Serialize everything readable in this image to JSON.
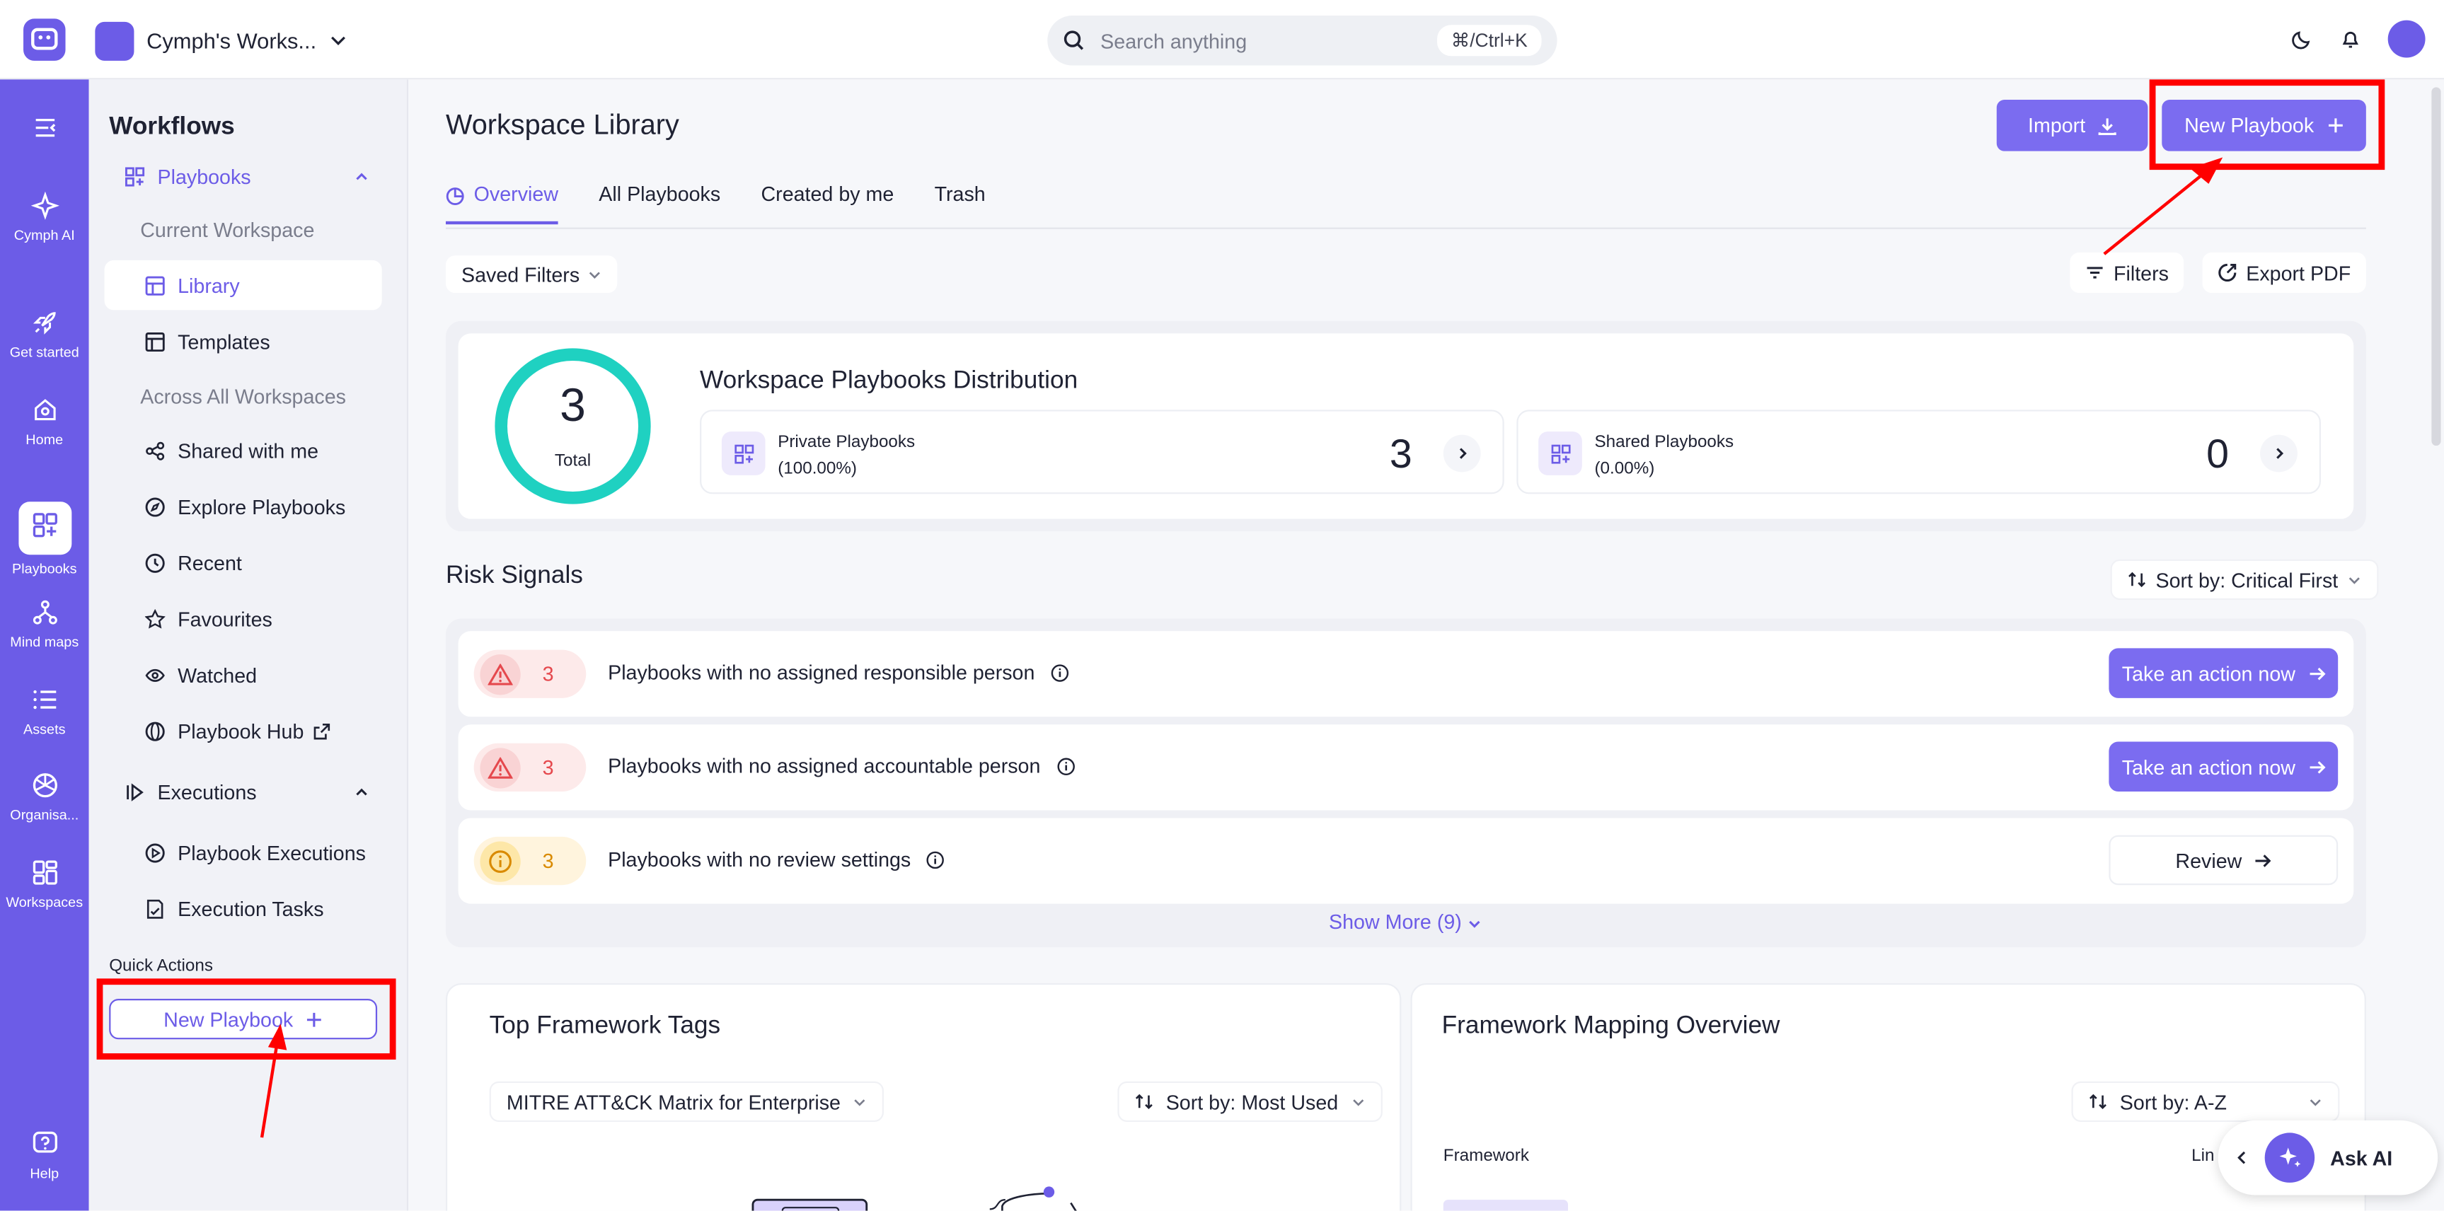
{
  "topbar": {
    "workspace_name": "Cymph's Works...",
    "search_placeholder": "Search anything",
    "search_shortcut": "⌘/Ctrl+K"
  },
  "rail": {
    "items": [
      {
        "label": "Cymph AI"
      },
      {
        "label": "Get started"
      },
      {
        "label": "Home"
      },
      {
        "label": "Playbooks"
      },
      {
        "label": "Mind maps"
      },
      {
        "label": "Assets"
      },
      {
        "label": "Organisa..."
      },
      {
        "label": "Workspaces"
      },
      {
        "label": "Help"
      }
    ]
  },
  "sidenav": {
    "title": "Workflows",
    "playbooks_group": "Playbooks",
    "current_workspace": "Current Workspace",
    "library": "Library",
    "templates": "Templates",
    "across_all": "Across All Workspaces",
    "shared_with_me": "Shared with me",
    "explore": "Explore Playbooks",
    "recent": "Recent",
    "favourites": "Favourites",
    "watched": "Watched",
    "hub": "Playbook Hub",
    "executions_group": "Executions",
    "playbook_executions": "Playbook Executions",
    "execution_tasks": "Execution Tasks",
    "quick_actions": "Quick Actions",
    "new_playbook": "New Playbook"
  },
  "main": {
    "title": "Workspace Library",
    "import": "Import",
    "new_playbook": "New Playbook",
    "tabs": [
      "Overview",
      "All Playbooks",
      "Created by me",
      "Trash"
    ],
    "saved_filters": "Saved Filters",
    "filters": "Filters",
    "export_pdf": "Export PDF",
    "distribution": {
      "total": "3",
      "total_label": "Total",
      "title": "Workspace Playbooks Distribution",
      "private_label": "Private Playbooks",
      "private_pct": "(100.00%)",
      "private_count": "3",
      "shared_label": "Shared Playbooks",
      "shared_pct": "(0.00%)",
      "shared_count": "0"
    },
    "risk": {
      "title": "Risk Signals",
      "sort": "Sort by: Critical First",
      "rows": [
        {
          "count": "3",
          "text": "Playbooks with no assigned responsible person",
          "action": "Take an action now"
        },
        {
          "count": "3",
          "text": "Playbooks with no assigned accountable person",
          "action": "Take an action now"
        },
        {
          "count": "3",
          "text": "Playbooks with no review settings",
          "action": "Review"
        }
      ],
      "show_more": "Show More (9)"
    },
    "framework_tags": {
      "title": "Top Framework Tags",
      "matrix": "MITRE ATT&CK Matrix for Enterprise",
      "sort": "Sort by: Most Used"
    },
    "framework_mapping": {
      "title": "Framework Mapping Overview",
      "sort": "Sort by: A-Z",
      "col_framework": "Framework",
      "col_linked": "Lin"
    }
  },
  "ask_ai": "Ask AI",
  "colors": {
    "accent": "#6c5ce7",
    "danger": "#e5484d",
    "warning": "#f5a623",
    "teal": "#1fd1c1"
  }
}
